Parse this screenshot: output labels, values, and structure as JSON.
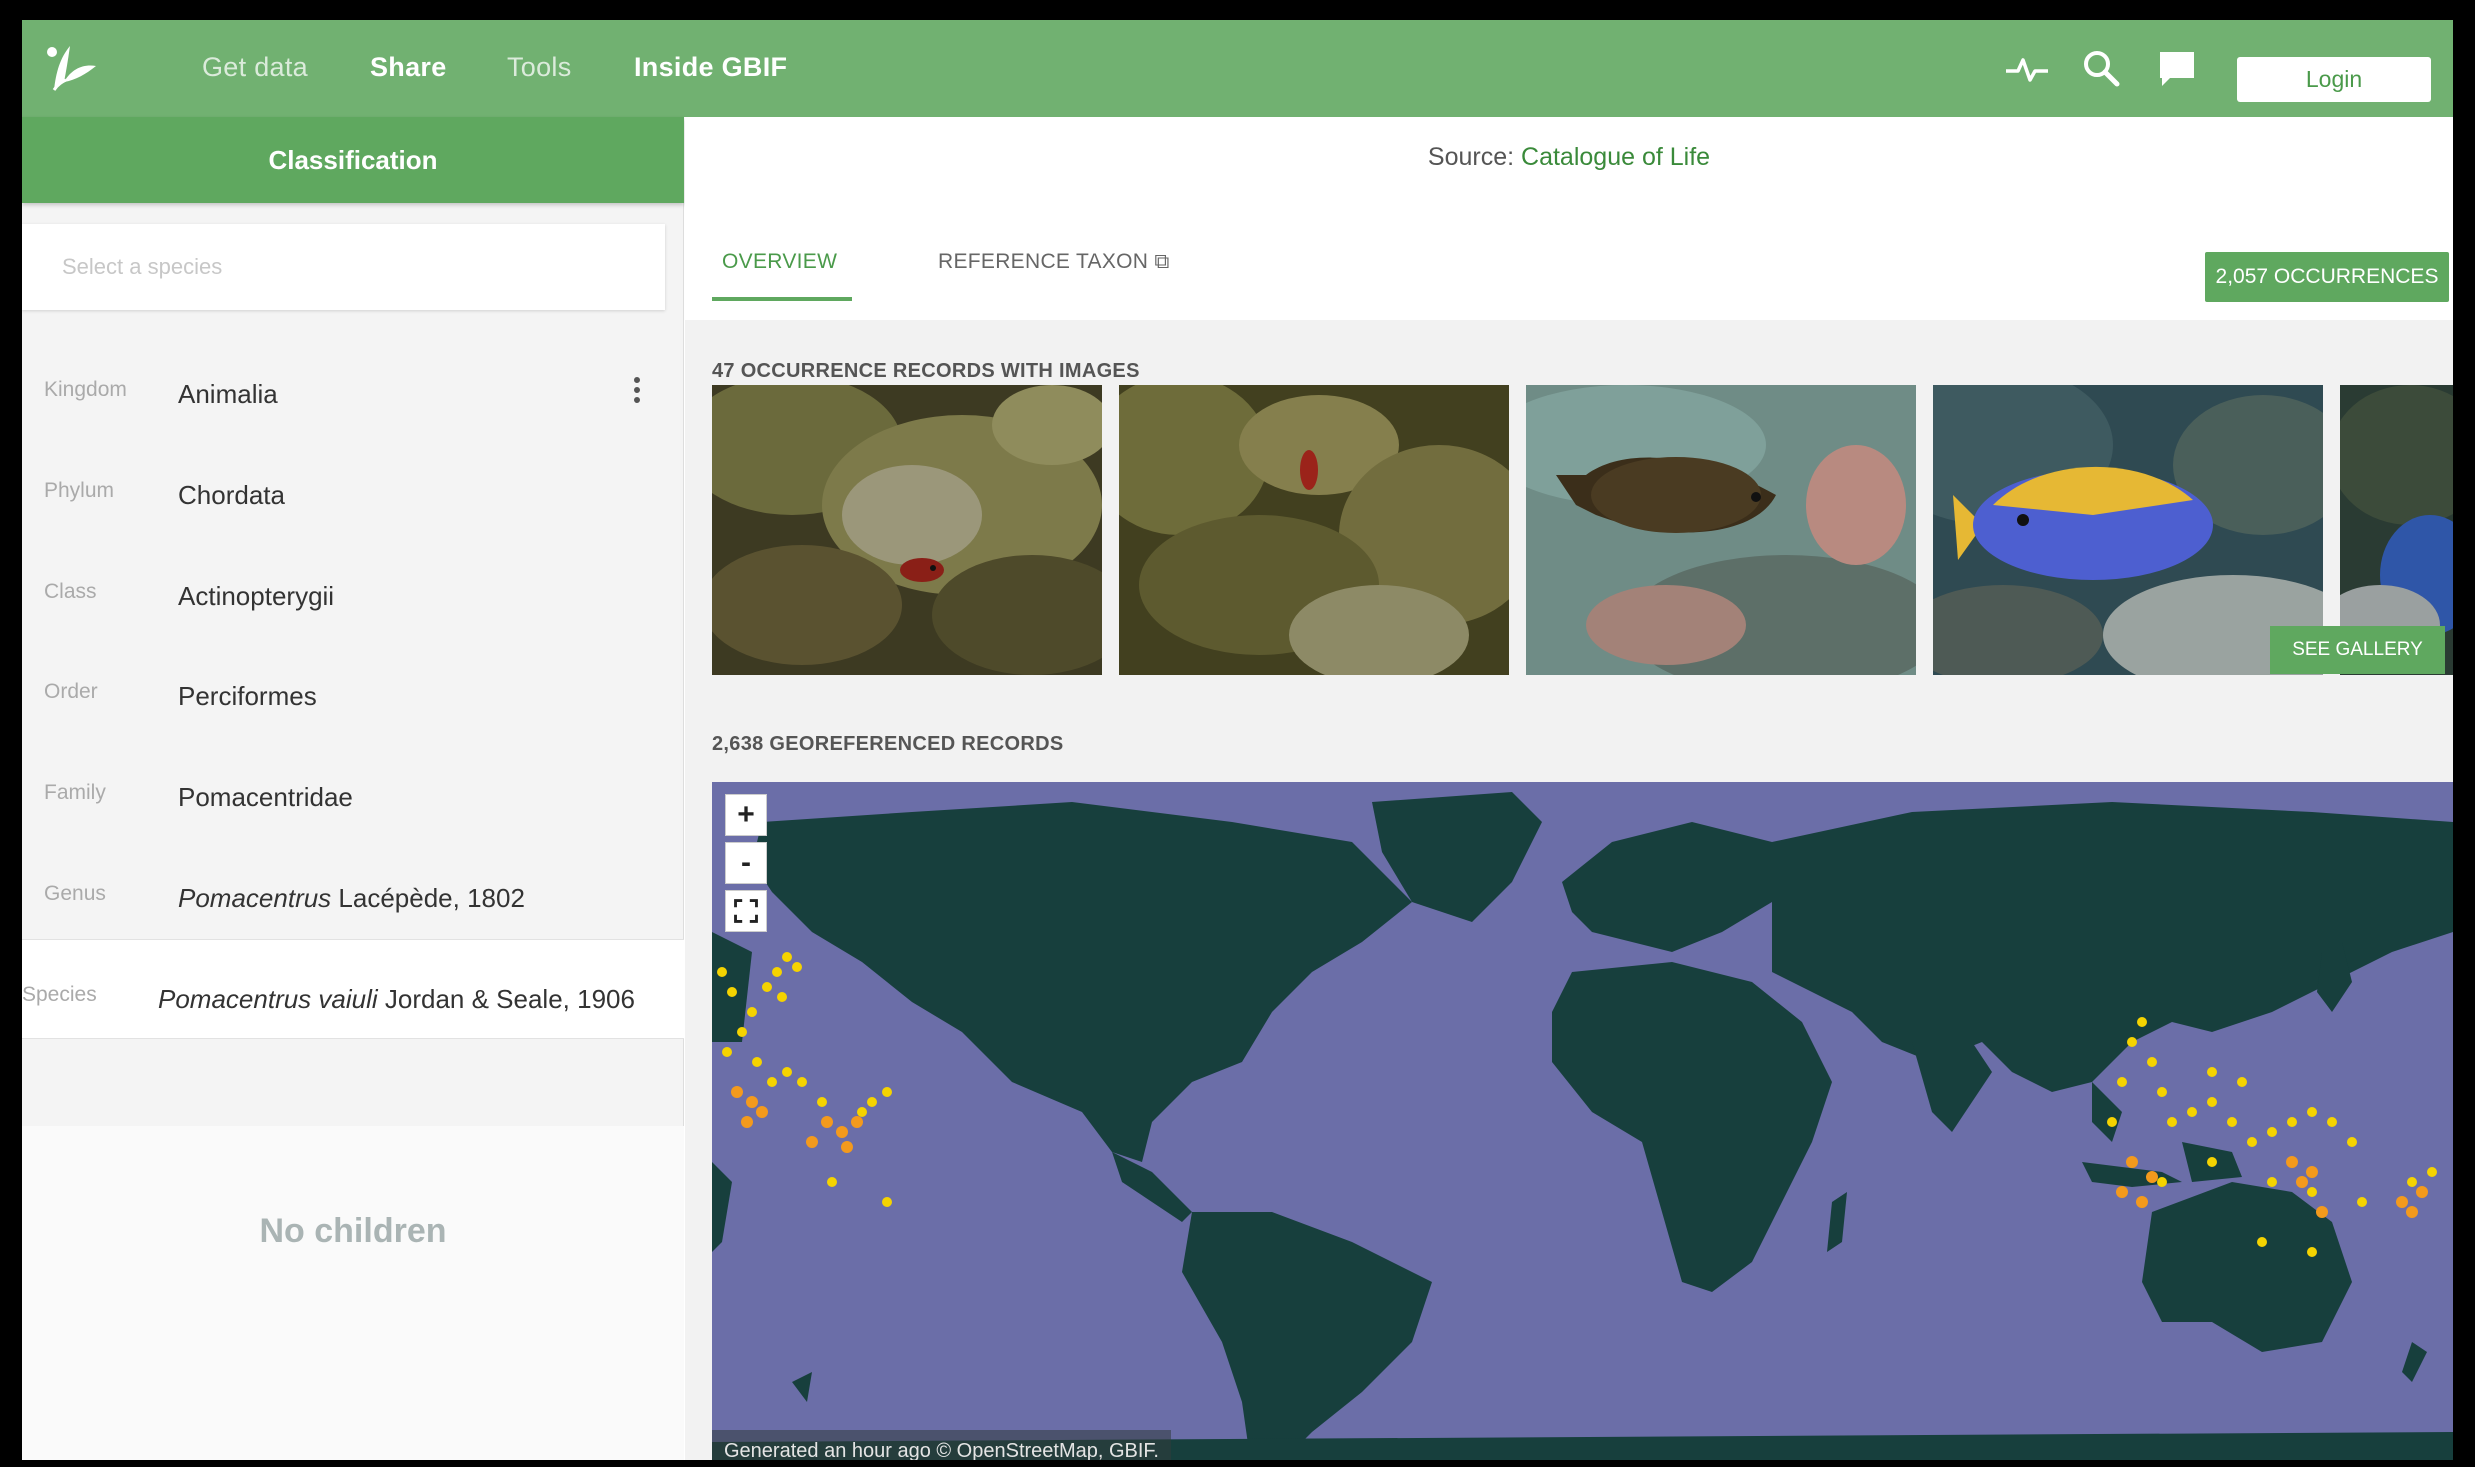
{
  "nav": {
    "logo_icon": "gbif-leaf-icon",
    "items": [
      "Get data",
      "Share",
      "Tools",
      "Inside GBIF"
    ],
    "icons": [
      "activity-icon",
      "search-icon",
      "chat-icon"
    ],
    "login_label": "Login"
  },
  "sidebar": {
    "header": "Classification",
    "search_placeholder": "Select a species",
    "ranks": [
      {
        "label": "Kingdom",
        "value": "Animalia"
      },
      {
        "label": "Phylum",
        "value": "Chordata"
      },
      {
        "label": "Class",
        "value": "Actinopterygii"
      },
      {
        "label": "Order",
        "value": "Perciformes"
      },
      {
        "label": "Family",
        "value": "Pomacentridae"
      },
      {
        "label": "Genus",
        "value_italic": "Pomacentrus",
        "value_rest": " Lacépède, 1802"
      },
      {
        "label": "Species",
        "value_italic": "Pomacentrus vaiuli",
        "value_rest": " Jordan & Seale, 1906"
      }
    ],
    "no_children": "No children"
  },
  "main": {
    "source_prefix": "Source: ",
    "source_link": "Catalogue of Life",
    "tabs": [
      {
        "label": "OVERVIEW",
        "active": true
      },
      {
        "label": "REFERENCE TAXON ⧉",
        "active": false
      }
    ],
    "occurrences_button": "2,057 OCCURRENCES",
    "images_section_title": "47 OCCURRENCE RECORDS WITH IMAGES",
    "see_gallery": "SEE GALLERY",
    "georef_section_title": "2,638 GEOREFERENCED RECORDS",
    "map": {
      "zoom_in": "+",
      "zoom_out": "-",
      "fullscreen_icon": "fullscreen-icon",
      "attribution": "Generated an hour ago © OpenStreetMap, GBIF."
    }
  },
  "colors": {
    "brand_green": "#71b171",
    "accent_green": "#5fa85f",
    "map_ocean": "#6b6ea8",
    "map_land": "#173f3d",
    "marker_yellow": "#f5d300",
    "marker_orange": "#f39a1d"
  }
}
